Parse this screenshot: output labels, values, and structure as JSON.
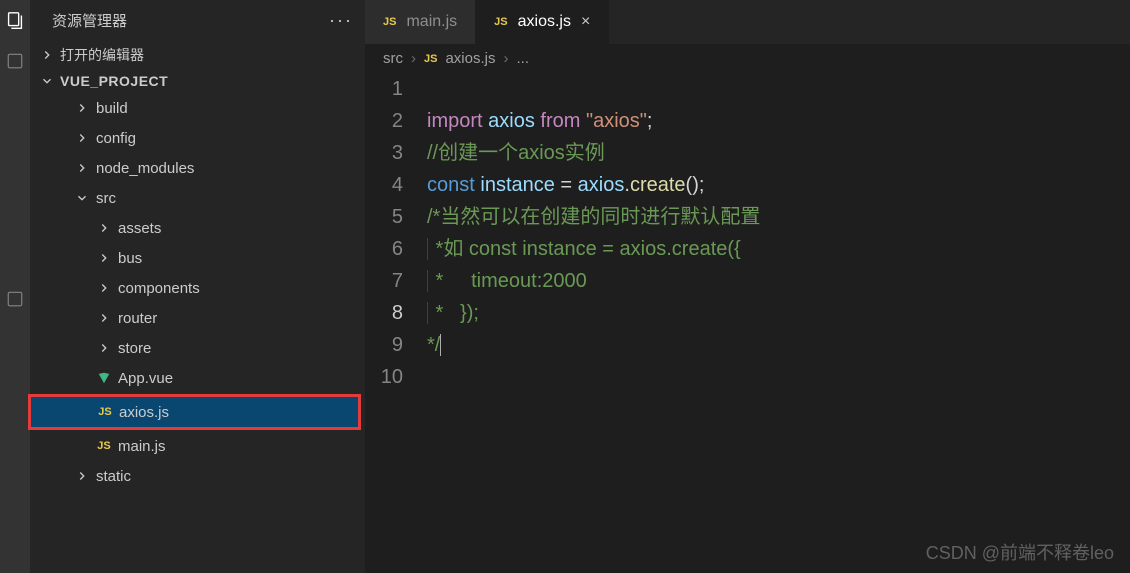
{
  "activity": {
    "icons": [
      "files",
      "square1",
      "square2"
    ]
  },
  "sidebar": {
    "title": "资源管理器",
    "open_editors": "打开的编辑器",
    "project": "VUE_PROJECT",
    "items": [
      {
        "label": "build",
        "type": "folder",
        "depth": 1,
        "expanded": false
      },
      {
        "label": "config",
        "type": "folder",
        "depth": 1,
        "expanded": false
      },
      {
        "label": "node_modules",
        "type": "folder",
        "depth": 1,
        "expanded": false
      },
      {
        "label": "src",
        "type": "folder",
        "depth": 1,
        "expanded": true
      },
      {
        "label": "assets",
        "type": "folder",
        "depth": 2,
        "expanded": false
      },
      {
        "label": "bus",
        "type": "folder",
        "depth": 2,
        "expanded": false
      },
      {
        "label": "components",
        "type": "folder",
        "depth": 2,
        "expanded": false
      },
      {
        "label": "router",
        "type": "folder",
        "depth": 2,
        "expanded": false
      },
      {
        "label": "store",
        "type": "folder",
        "depth": 2,
        "expanded": false
      },
      {
        "label": "App.vue",
        "type": "vue",
        "depth": 2
      },
      {
        "label": "axios.js",
        "type": "js",
        "depth": 2,
        "highlighted": true,
        "selected": true
      },
      {
        "label": "main.js",
        "type": "js",
        "depth": 2
      },
      {
        "label": "static",
        "type": "folder",
        "depth": 1,
        "expanded": false
      }
    ]
  },
  "tabs": [
    {
      "label": "main.js",
      "icon": "JS",
      "active": false
    },
    {
      "label": "axios.js",
      "icon": "JS",
      "active": true,
      "closable": true
    }
  ],
  "breadcrumb": {
    "parts": [
      "src",
      "axios.js",
      "..."
    ],
    "icon": "JS"
  },
  "code": {
    "lines": [
      1,
      2,
      3,
      4,
      5,
      6,
      7,
      8,
      9,
      10
    ],
    "current_line": 8,
    "l1": {
      "imp": "import",
      "name": "axios",
      "from": "from",
      "str": "\"axios\""
    },
    "l2": "//创建一个axios实例",
    "l3": {
      "const": "const",
      "name": "instance",
      "eq": " = ",
      "obj": "axios",
      "dot": ".",
      "fn": "create",
      "paren": "();"
    },
    "l4": "/*当然可以在创建的同时进行默认配置",
    "l5": " *如 const instance = axios.create({",
    "l6": " *     timeout:2000",
    "l7": " *   });",
    "l8": "*/"
  },
  "watermark": "CSDN @前端不释卷leo"
}
